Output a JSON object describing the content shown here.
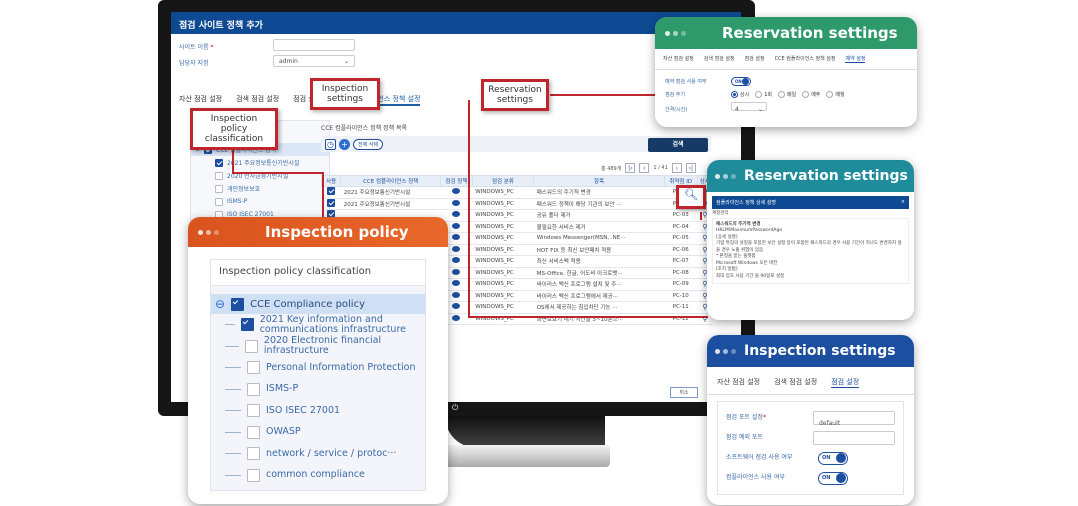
{
  "window": {
    "title": "점검 사이트 정책 추가"
  },
  "form": {
    "site_name_label": "사이트 이름",
    "site_name_required": "*",
    "site_name_value": "",
    "manager_label": "담당자 지정",
    "manager_value": "admin"
  },
  "tabs": [
    "자산 점검 설정",
    "검색 점검 설정",
    "점검 설정",
    "CCE 컴플라이언스 정책 설정"
  ],
  "tree": {
    "root": "CCE 컴플라이언스 정책",
    "items": [
      {
        "label": "2021 주요정보통신기반시설",
        "checked": true
      },
      {
        "label": "2020 전자금융기반시설",
        "checked": false
      },
      {
        "label": "개인정보보호",
        "checked": false
      },
      {
        "label": "ISMS-P",
        "checked": false
      },
      {
        "label": "ISO ISEC 27001",
        "checked": false
      }
    ]
  },
  "list": {
    "title": "CCE 컴플라이언스 정책 정책 목록",
    "delete_all": "전체 삭제",
    "search_button": "검색",
    "total": "총 489개",
    "page": "1 / 41",
    "columns": [
      "사용",
      "CCE 컴플라이언스 정책",
      "점검 정책",
      "점검 분류",
      "항목",
      "취약점 ID",
      "상세"
    ],
    "rows": [
      {
        "use": true,
        "policy": "2021 주요정보통신기반시설",
        "category": "WINDOWS_PC",
        "item": "패스워드의 주기적 변경",
        "id": "PC-01"
      },
      {
        "use": true,
        "policy": "2021 주요정보통신기반시설",
        "category": "WINDOWS_PC",
        "item": "패스워드 정책이 해당 기관의 보안 ···",
        "id": "PC-02"
      },
      {
        "use": true,
        "policy": "",
        "category": "WINDOWS_PC",
        "item": "공유 폴더 제거",
        "id": "PC-03"
      },
      {
        "use": true,
        "policy": "",
        "category": "WINDOWS_PC",
        "item": "불필요한 서비스 제거",
        "id": "PC-04"
      },
      {
        "use": true,
        "policy": "",
        "category": "WINDOWS_PC",
        "item": "Windows Messenger(MSN, .NE···",
        "id": "PC-05"
      },
      {
        "use": true,
        "policy": "",
        "category": "WINDOWS_PC",
        "item": "HOT FIX 등 최신 보안패치 적용",
        "id": "PC-06"
      },
      {
        "use": true,
        "policy": "",
        "category": "WINDOWS_PC",
        "item": "최신 서비스팩 적용",
        "id": "PC-07"
      },
      {
        "use": true,
        "policy": "",
        "category": "WINDOWS_PC",
        "item": "MS-Office, 한글, 어도비 아크로뱃···",
        "id": "PC-08"
      },
      {
        "use": true,
        "policy": "",
        "category": "WINDOWS_PC",
        "item": "바이러스 백신 프로그램 설치 및 주···",
        "id": "PC-09"
      },
      {
        "use": true,
        "policy": "",
        "category": "WINDOWS_PC",
        "item": "바이러스 백신 프로그램에서 제공···",
        "id": "PC-10"
      },
      {
        "use": true,
        "policy": "",
        "category": "WINDOWS_PC",
        "item": "OS에서 제공하는 침입차단 기능 ···",
        "id": "PC-11"
      },
      {
        "use": true,
        "policy": "",
        "category": "WINDOWS_PC",
        "item": "화면보호기 대기 시간을 5~10분으···",
        "id": "PC-12"
      }
    ],
    "cancel_button": "취소"
  },
  "callouts": {
    "inspection_settings": "Inspection settings",
    "reservation_settings": "Reservation settings",
    "policy_classification": "Inspection policy classification"
  },
  "card_reservation1": {
    "title": "Reservation settings",
    "color": "#2e9a6c",
    "tabs": [
      "자산 점검 설정",
      "검색 점검 설정",
      "점검 설정",
      "CCE 컴플라이언스 정책 설정",
      "예약 설정"
    ],
    "use_label": "예약 점검 사용 여부",
    "toggle": "ON",
    "cycle_label": "점검 주기",
    "cycle_options": [
      "상시",
      "1회",
      "매일",
      "매주",
      "매월"
    ],
    "interval_label": "간격(시간)",
    "interval_value": "4"
  },
  "card_reservation2": {
    "title": "Reservation settings",
    "color": "#1f8c9c",
    "dialog_title": "컴플라이언스 정책 상세 설명",
    "section": "계정관리",
    "heading": "패스워드의 주기적 변경",
    "code": "HKLM\\MaximumPasswordAge",
    "body1": "[상세 설명]",
    "body2": "기업 특징의 설정을 포함한 보안 설정 등이 포함된 패스워드의 경우 사용 기간이 지나도 변경하지 않을 경우 노출 위험이 있음",
    "body3": "* 판정을 받는 플랫폼",
    "body4": "Microsoft Windows 모든 버전",
    "body5": "[조치 방법]",
    "body6": "최대 암호 사용 기간 을 90일로 설정"
  },
  "card_inspection": {
    "title": "Inspection settings",
    "color": "#1d4fa0",
    "tabs": [
      "자산 점검 설정",
      "검색 점검 설정",
      "점검 설정"
    ],
    "port_label": "점검 포트 설정",
    "port_value": "default",
    "except_label": "점검 예외 포트",
    "except_value": "",
    "software_label": "소프트웨어 점검 사용 여부",
    "compliance_label": "컴플라이언스 사용 여부",
    "toggle": "ON"
  },
  "card_policy": {
    "title": "Inspection policy",
    "color": "#d9531e",
    "panel_title": "Inspection policy classification",
    "root": "CCE Compliance policy",
    "items": [
      {
        "label": "2021 Key information and communications infrastructure",
        "checked": true
      },
      {
        "label": "2020 Electronic financial infrastructure",
        "checked": false
      },
      {
        "label": "Personal Information Protection",
        "checked": false
      },
      {
        "label": "ISMS-P",
        "checked": false
      },
      {
        "label": "ISO ISEC 27001",
        "checked": false
      },
      {
        "label": "OWASP",
        "checked": false
      },
      {
        "label": "network / service / protoc···",
        "checked": false
      },
      {
        "label": "common compliance",
        "checked": false
      }
    ]
  }
}
